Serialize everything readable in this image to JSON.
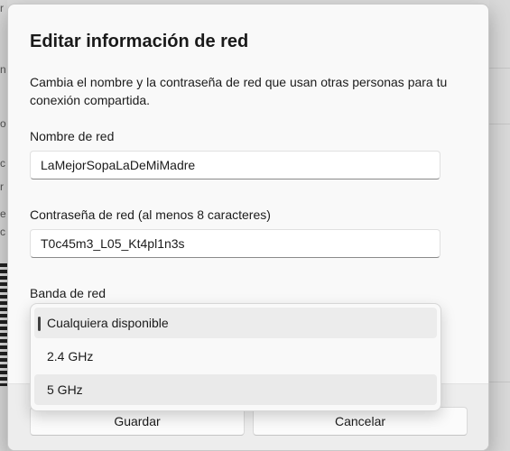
{
  "background": {
    "fragments": [
      "r r…",
      "n",
      "o",
      "c",
      "r",
      "e",
      "c"
    ]
  },
  "dialog": {
    "title": "Editar información de red",
    "description": "Cambia el nombre y la contraseña de red que usan otras personas para tu conexión compartida.",
    "network_name": {
      "label": "Nombre de red",
      "value": "LaMejorSopaLaDeMiMadre"
    },
    "network_password": {
      "label": "Contraseña de red (al menos 8 caracteres)",
      "value": "T0c45m3_L05_Kt4pl1n3s"
    },
    "network_band": {
      "label": "Banda de red",
      "options": [
        {
          "label": "Cualquiera disponible",
          "selected": true
        },
        {
          "label": "2.4 GHz",
          "selected": false
        },
        {
          "label": "5 GHz",
          "selected": false
        }
      ]
    },
    "buttons": {
      "save": "Guardar",
      "cancel": "Cancelar"
    }
  },
  "colors": {
    "dialog_bg": "#f9f9f9",
    "footer_bg": "#ededed",
    "selected_indicator": "#404040"
  }
}
